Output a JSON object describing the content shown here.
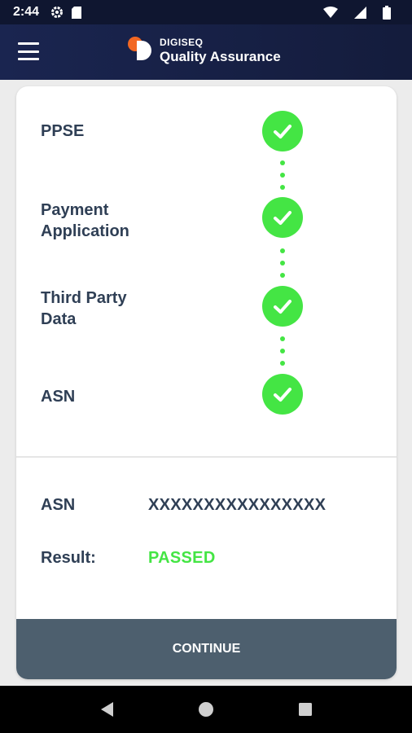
{
  "status_bar": {
    "time": "2:44",
    "icons": [
      "gear-icon",
      "sd-card-icon",
      "wifi-icon",
      "signal-icon",
      "battery-icon"
    ]
  },
  "app_bar": {
    "brand_small": "DIGISEQ",
    "brand_large": "Quality Assurance",
    "menu_icon": "hamburger-menu-icon"
  },
  "steps": [
    {
      "label_line1": "PPSE",
      "label_line2": "",
      "status": "complete"
    },
    {
      "label_line1": "Payment",
      "label_line2": "Application",
      "status": "complete"
    },
    {
      "label_line1": "Third Party",
      "label_line2": "Data",
      "status": "complete"
    },
    {
      "label_line1": "ASN",
      "label_line2": "",
      "status": "complete"
    }
  ],
  "info": {
    "asn_label": "ASN",
    "asn_value": "XXXXXXXXXXXXXXXX",
    "result_label": "Result:",
    "result_value": "PASSED"
  },
  "continue_label": "CONTINUE",
  "colors": {
    "accent_green": "#44e544",
    "header_navy": "#1a2550",
    "button_slate": "#4d5f6e",
    "label_text": "#2f3f55"
  },
  "nav_bar": {
    "icons": [
      "back-icon",
      "home-icon",
      "recents-icon"
    ]
  }
}
